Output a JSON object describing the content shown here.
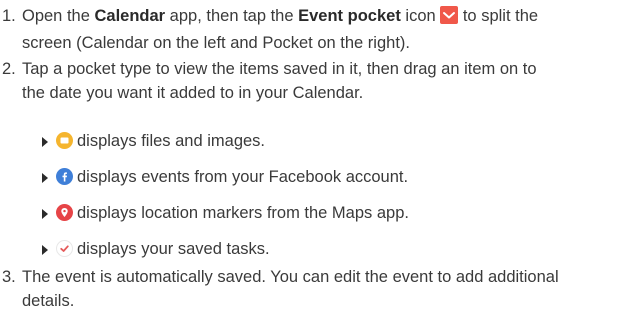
{
  "steps": [
    {
      "number": "1.",
      "line1_pre": "Open the ",
      "app_name": "Calendar",
      "line1_mid": " app, then tap the ",
      "icon_label": "Event pocket",
      "line1_mid2": " icon ",
      "line1_post": " to split the",
      "line2": "screen (Calendar on the left and Pocket on the right)."
    },
    {
      "number": "2.",
      "line1": "Tap a pocket type to view the items saved in it, then drag an item on to",
      "line2": "the date you want it added to in your Calendar."
    },
    {
      "number": "3.",
      "line1": "The event is automatically saved. You can edit the event to add additional",
      "line2": "details."
    }
  ],
  "pocket_types": [
    {
      "icon": "folder-icon",
      "color": "#f5b52e",
      "text": "displays files and images."
    },
    {
      "icon": "facebook-icon",
      "color": "#3f7fd8",
      "text": "displays events from your Facebook account."
    },
    {
      "icon": "location-marker-icon",
      "color": "#e64447",
      "text": "displays location markers from the Maps app."
    },
    {
      "icon": "checkmark-icon",
      "color": "#e55a5a",
      "text": "displays your saved tasks."
    }
  ],
  "colors": {
    "event_pocket_icon": "#f0584a",
    "text": "#3a3a3a"
  }
}
